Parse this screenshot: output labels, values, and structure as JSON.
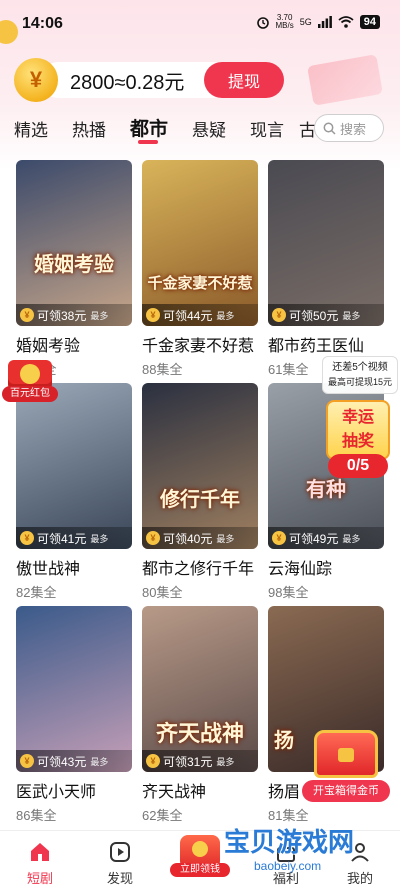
{
  "status_bar": {
    "time": "14:06",
    "net_speed_value": "3.70",
    "net_speed_unit": "MB/s",
    "signal": "5G",
    "battery": "94"
  },
  "wallet": {
    "coin_symbol": "¥",
    "balance_text": "2800≈0.28元",
    "withdraw_label": "提现"
  },
  "tabs": {
    "items": [
      "精选",
      "热播",
      "都市",
      "悬疑",
      "现言"
    ],
    "active": "都市",
    "overflow_peek": "古",
    "search_placeholder": "搜索"
  },
  "dramas": [
    {
      "title": "婚姻考验",
      "episodes": "74集全",
      "poster_text": "婚姻考验",
      "reward": "可领38元",
      "reward_suffix": "最多",
      "colors": [
        "#3b4a6b",
        "#c9a78a"
      ]
    },
    {
      "title": "千金家妻不好惹",
      "episodes": "88集全",
      "poster_text": "千金家妻不好惹",
      "reward": "可领44元",
      "reward_suffix": "最多",
      "colors": [
        "#d9b45a",
        "#8a5a2a"
      ]
    },
    {
      "title": "都市药王医仙",
      "episodes": "61集全",
      "poster_text": "",
      "reward": "可领50元",
      "reward_suffix": "最多",
      "colors": [
        "#4a4a52",
        "#7a6d66"
      ]
    },
    {
      "title": "傲世战神",
      "episodes": "82集全",
      "poster_text": "",
      "reward": "可领41元",
      "reward_suffix": "最多",
      "colors": [
        "#9aa8b8",
        "#3a4658"
      ]
    },
    {
      "title": "都市之修行千年",
      "episodes": "80集全",
      "poster_text": "修行千年",
      "reward": "可领40元",
      "reward_suffix": "最多",
      "colors": [
        "#2a3040",
        "#a08060"
      ]
    },
    {
      "title": "云海仙踪",
      "episodes": "98集全",
      "poster_text": "有种",
      "reward": "可领49元",
      "reward_suffix": "最多",
      "colors": [
        "#9aa0a8",
        "#4b5058"
      ]
    },
    {
      "title": "医武小天师",
      "episodes": "86集全",
      "poster_text": "",
      "reward": "可领43元",
      "reward_suffix": "最多",
      "colors": [
        "#3a5a8a",
        "#c7a0b8"
      ]
    },
    {
      "title": "齐天战神",
      "episodes": "62集全",
      "poster_text": "齐天战神",
      "reward": "可领31元",
      "reward_suffix": "最多",
      "colors": [
        "#b89a88",
        "#5a4a48"
      ]
    },
    {
      "title": "扬眉",
      "episodes": "81集全",
      "poster_text": "扬",
      "reward": "",
      "reward_suffix": "",
      "colors": [
        "#8a6a52",
        "#3a2a28"
      ]
    }
  ],
  "floating": {
    "red_packet_label": "百元红包",
    "video_tip_line1": "还差5个视频",
    "video_tip_line2": "最高可提现15元",
    "lottery_line1": "幸运",
    "lottery_line2": "抽奖",
    "lottery_count": "0/5",
    "treasure_label": "开宝箱得金币"
  },
  "bottom_nav": {
    "items": [
      {
        "label": "短剧",
        "icon": "home-icon",
        "active": true
      },
      {
        "label": "发现",
        "icon": "play-icon",
        "active": false
      },
      {
        "label": "",
        "icon": "gift-icon",
        "tag": "立即领钱"
      },
      {
        "label": "福利",
        "icon": "welfare-icon",
        "active": false
      },
      {
        "label": "我的",
        "icon": "profile-icon",
        "active": false
      }
    ]
  },
  "watermark": {
    "line1": "宝贝游戏网",
    "line2": "baobeiy.com"
  },
  "colors": {
    "accent": "#f0364e",
    "coin": "#f6c343"
  }
}
